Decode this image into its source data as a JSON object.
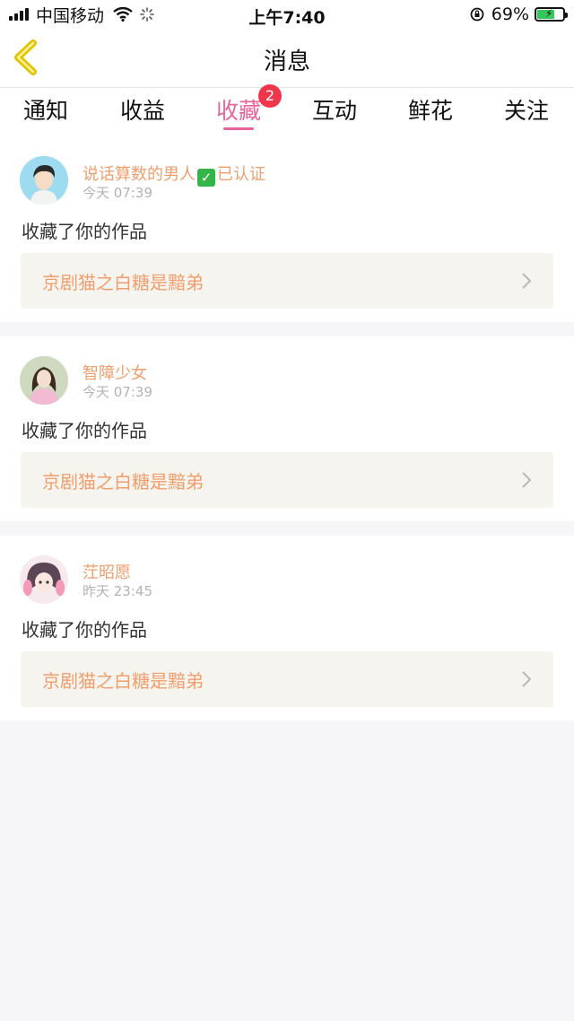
{
  "status_bar": {
    "carrier": "中国移动",
    "time": "上午7:40",
    "battery_pct": "69%",
    "battery_level": 0.69,
    "icons": [
      "signal-icon",
      "wifi-icon",
      "loading-icon",
      "orientation-lock-icon",
      "battery-icon"
    ]
  },
  "nav": {
    "title": "消息",
    "back_icon": "chevron-left-icon"
  },
  "tabs": [
    {
      "label": "通知"
    },
    {
      "label": "收益"
    },
    {
      "label": "收藏",
      "badge": "2",
      "active": true
    },
    {
      "label": "互动"
    },
    {
      "label": "鲜花"
    },
    {
      "label": "关注"
    }
  ],
  "colors": {
    "accent_pink": "#e8639a",
    "name_orange": "#ef9e6e",
    "badge_red": "#f0364b",
    "verified_green": "#35b44a"
  },
  "notifications": [
    {
      "user": "说话算数的男人",
      "verified_label": "已认证",
      "time": "今天 07:39",
      "action": "收藏了你的作品",
      "work": "京剧猫之白糖是黯弟"
    },
    {
      "user": "智障少女",
      "time": "今天 07:39",
      "action": "收藏了你的作品",
      "work": "京剧猫之白糖是黯弟"
    },
    {
      "user": "茳昭愿",
      "time": "昨天 23:45",
      "action": "收藏了你的作品",
      "work": "京剧猫之白糖是黯弟"
    }
  ]
}
